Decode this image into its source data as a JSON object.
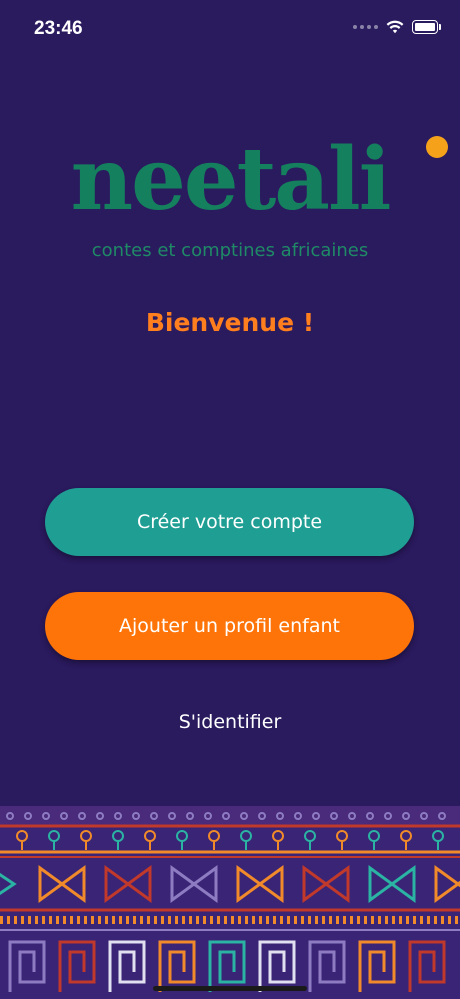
{
  "status_bar": {
    "time": "23:46"
  },
  "brand": {
    "name": "neetali",
    "tagline": "contes et comptines africaines"
  },
  "welcome": "Bienvenue !",
  "buttons": {
    "create_account": "Créer votre compte",
    "add_child_profile": "Ajouter un profil enfant",
    "login": "S'identifier"
  },
  "colors": {
    "background": "#2a1a5e",
    "brand_green": "#14805d",
    "accent_orange": "#ff7409",
    "teal": "#1f9e93"
  },
  "icons": [
    "wifi-icon",
    "battery-icon",
    "signal-dots-icon"
  ]
}
